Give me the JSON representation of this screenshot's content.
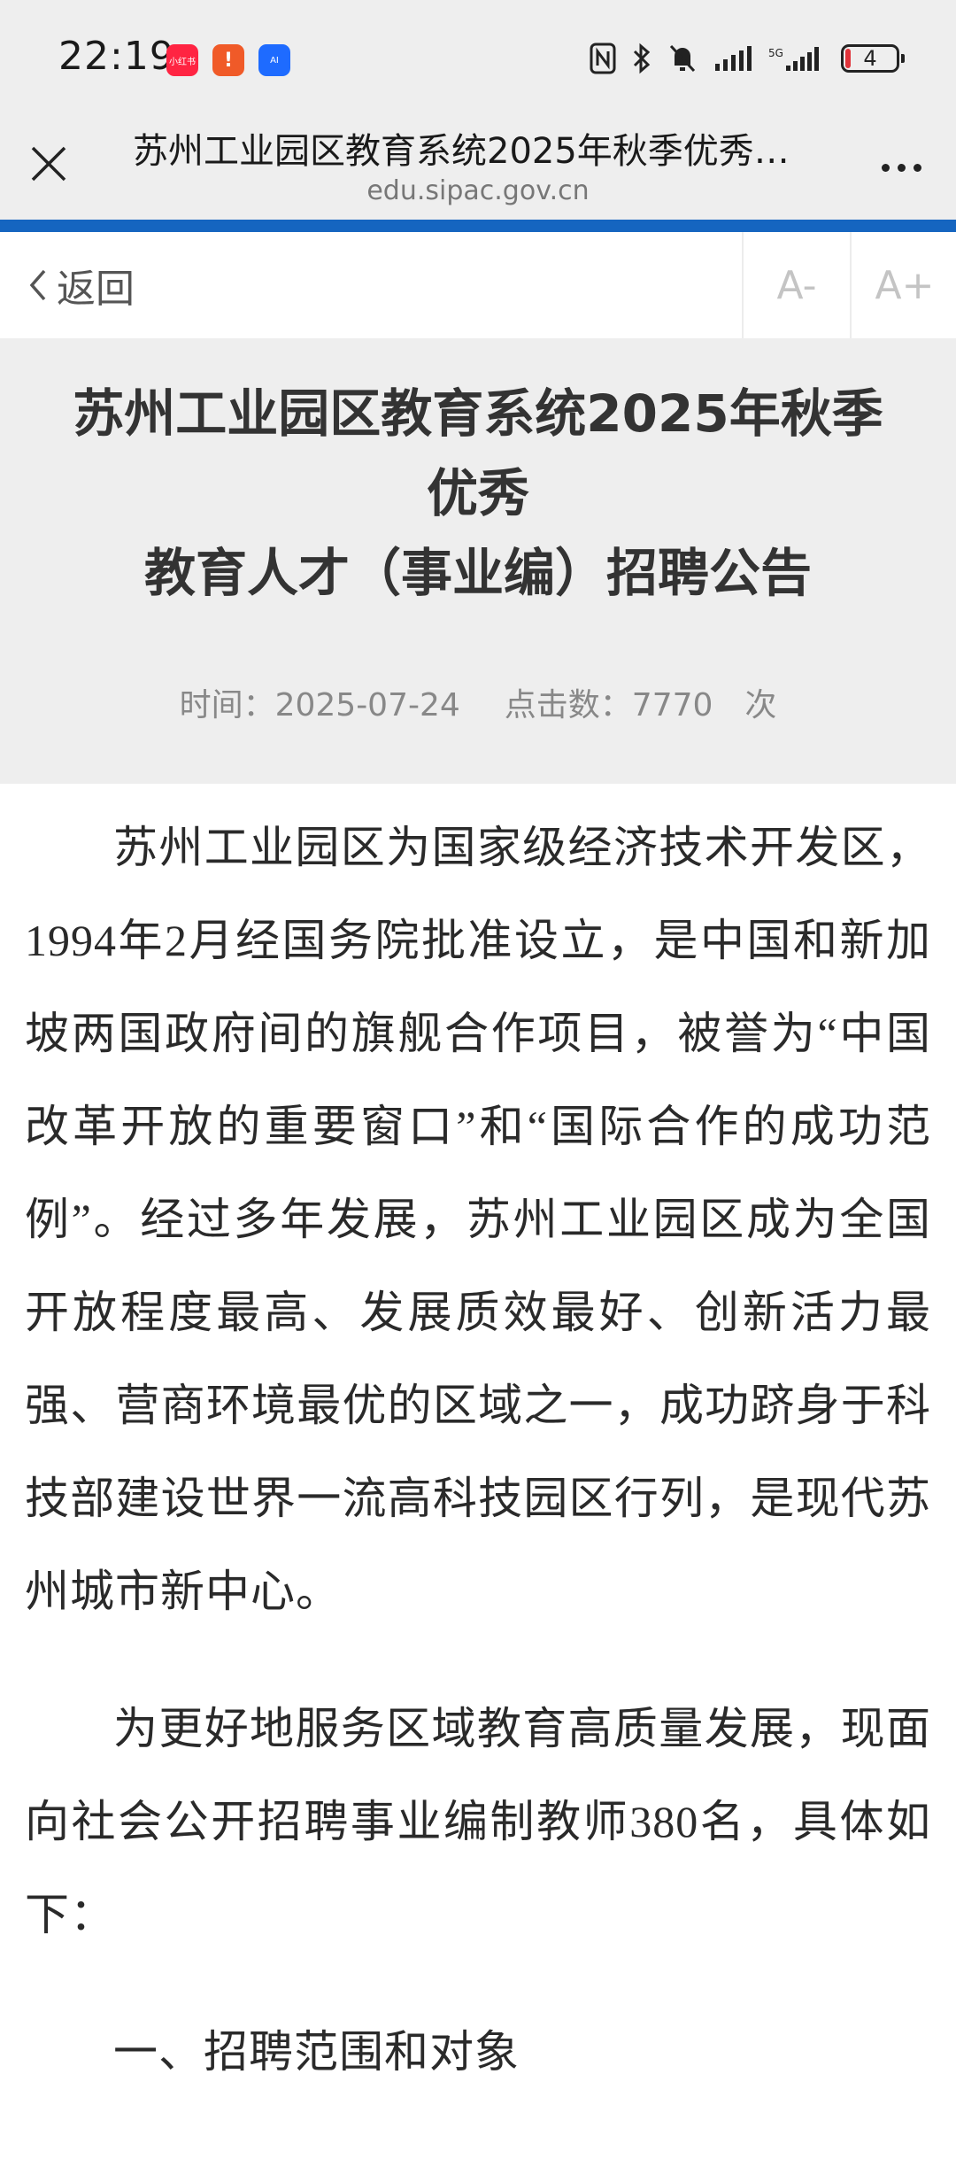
{
  "status_bar": {
    "time": "22:19",
    "app_badges": [
      {
        "label": "小红书",
        "color": "#ff2442"
      },
      {
        "label": "!",
        "color": "#f05a28"
      },
      {
        "label": "AI",
        "color": "#1e6bff"
      }
    ],
    "battery_level": "4"
  },
  "browser": {
    "page_title": "苏州工业园区教育系统2025年秋季优秀教育人才（事业编）招聘公告",
    "domain": "edu.sipac.gov.cn"
  },
  "toolbar": {
    "back_label": "返回",
    "font_decrease": "A-",
    "font_increase": "A+"
  },
  "article": {
    "title_lines": [
      "苏州工业园区教育系统2025年秋季",
      "优秀",
      "教育人才（事业编）招聘公告"
    ],
    "meta": {
      "date": "时间：2025-07-24",
      "clicks": "点击数：7770　次"
    },
    "paragraphs": [
      "苏州工业园区为国家级经济技术开发区，1994年2月经国务院批准设立，是中国和新加坡两国政府间的旗舰合作项目，被誉为“中国改革开放的重要窗口”和“国际合作的成功范例”。经过多年发展，苏州工业园区成为全国开放程度最高、发展质效最好、创新活力最强、营商环境最优的区域之一，成功跻身于科技部建设世界一流高科技园区行列，是现代苏州城市新中心。",
      "为更好地服务区域教育高质量发展，现面向社会公开招聘事业编制教师380名，具体如下："
    ],
    "section_heading": "一、招聘范围和对象"
  }
}
